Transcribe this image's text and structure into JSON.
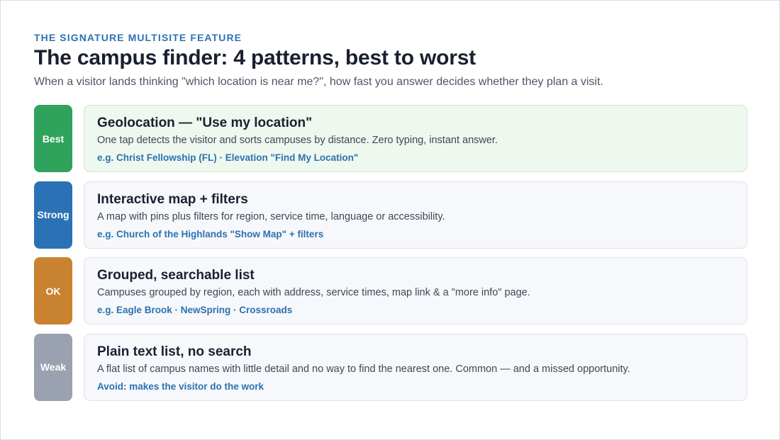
{
  "header": {
    "eyebrow": "THE SIGNATURE MULTISITE FEATURE",
    "title": "The campus finder: 4 patterns, best to worst",
    "subtitle": "When a visitor lands thinking \"which location is near me?\", how fast you answer decides whether they plan a visit."
  },
  "patterns": [
    {
      "badge": "Best",
      "badge_color": "#2fa35b",
      "title": "Geolocation — \"Use my location\"",
      "description": "One tap detects the visitor and sorts campuses by distance. Zero typing, instant answer.",
      "example": "e.g. Christ Fellowship (FL) · Elevation \"Find My Location\""
    },
    {
      "badge": "Strong",
      "badge_color": "#2a72b5",
      "title": "Interactive map + filters",
      "description": "A map with pins plus filters for region, service time, language or accessibility.",
      "example": "e.g. Church of the Highlands \"Show Map\" + filters"
    },
    {
      "badge": "OK",
      "badge_color": "#c98330",
      "title": "Grouped, searchable list",
      "description": "Campuses grouped by region, each with address, service times, map link & a \"more info\" page.",
      "example": "e.g. Eagle Brook · NewSpring · Crossroads"
    },
    {
      "badge": "Weak",
      "badge_color": "#9aa1b0",
      "title": "Plain text list, no search",
      "description": "A flat list of campus names with little detail and no way to find the nearest one. Common — and a missed opportunity.",
      "example": "Avoid: makes the visitor do the work"
    }
  ]
}
